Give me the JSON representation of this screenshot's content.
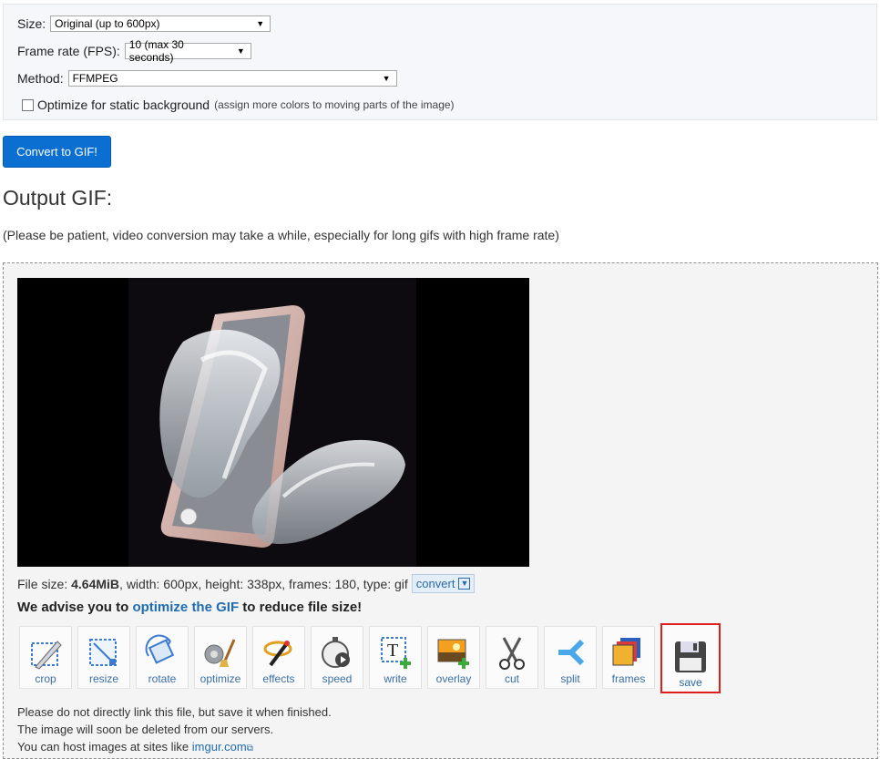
{
  "options": {
    "size_label": "Size:",
    "size_value": "Original (up to 600px)",
    "fps_label": "Frame rate (FPS):",
    "fps_value": "10 (max 30 seconds)",
    "method_label": "Method:",
    "method_value": "FFMPEG",
    "optimize_label": "Optimize for static background",
    "optimize_hint": "(assign more colors to moving parts of the image)"
  },
  "convert_button": "Convert to GIF!",
  "output": {
    "title": "Output GIF:",
    "note": "(Please be patient, video conversion may take a while, especially for long gifs with high frame rate)"
  },
  "file_info": {
    "prefix": "File size:",
    "size": "4.64MiB",
    "details": ", width: 600px, height: 338px, frames: 180, type: gif",
    "convert_label": "convert"
  },
  "advise": {
    "before": "We advise you to",
    "link": "optimize the GIF",
    "after": "to reduce file size!"
  },
  "tools": [
    "crop",
    "resize",
    "rotate",
    "optimize",
    "effects",
    "speed",
    "write",
    "overlay",
    "cut",
    "split",
    "frames",
    "save"
  ],
  "footer": {
    "line1": "Please do not directly link this file, but save it when finished.",
    "line2": "The image will soon be deleted from our servers.",
    "line3_prefix": "You can host images at sites like",
    "line3_link": "imgur.com"
  }
}
